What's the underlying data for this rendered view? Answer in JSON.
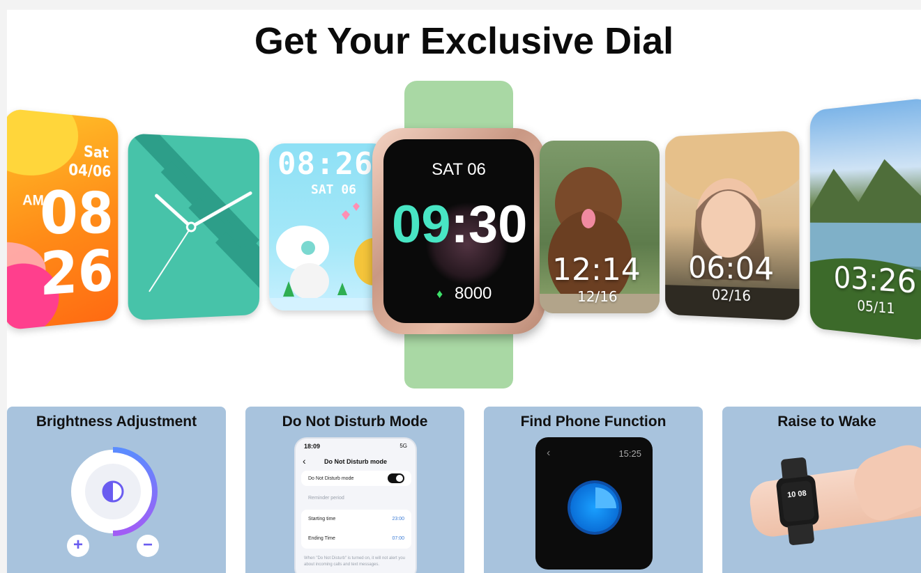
{
  "headline": "Get Your Exclusive Dial",
  "dials": {
    "orange": {
      "day": "Sat",
      "date": "04/06",
      "ampm": "AM",
      "hour": "08",
      "minute": "26"
    },
    "teal": {
      "style": "analog"
    },
    "cartoon": {
      "time": "08:26",
      "day": "SAT 06"
    },
    "dog": {
      "time": "12:14",
      "date": "12/16"
    },
    "girl": {
      "time": "06:04",
      "date": "02/16"
    },
    "lake": {
      "time": "03:26",
      "date": "05/11"
    }
  },
  "main_watch": {
    "day": "SAT 06",
    "hour": "09",
    "colon": ":",
    "minute": "30",
    "steps": "8000",
    "steps_icon": "footprints-icon",
    "colors": {
      "hour": "#48e6c4",
      "strap": "#a9d8a4",
      "case": "#c99884"
    }
  },
  "features": [
    {
      "title": "Brightness Adjustment",
      "plus": "+",
      "minus": "−"
    },
    {
      "title": "Do Not Disturb Mode",
      "phone": {
        "clock": "18:09",
        "signal": "5G",
        "screen_title": "Do Not Disturb mode",
        "toggle_label": "Do Not Disturb mode",
        "reminder": "Reminder period",
        "start_label": "Starting time",
        "start_value": "23:00",
        "end_label": "Ending Time",
        "end_value": "07:00",
        "hint": "When \"Do Not Disturb\" is turned on, it will not alert you about incoming calls and text messages."
      }
    },
    {
      "title": "Find Phone Function",
      "watch_time": "15:25"
    },
    {
      "title": "Raise to Wake",
      "watch_time": "10 08"
    }
  ]
}
